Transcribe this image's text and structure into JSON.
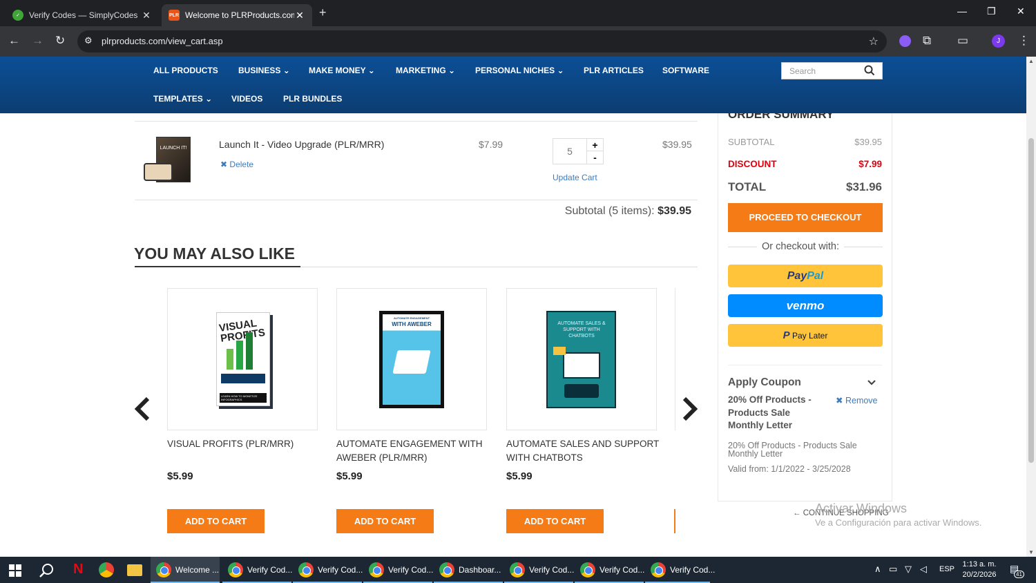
{
  "browser": {
    "tabs": [
      {
        "title": "Verify Codes — SimplyCodes",
        "active": false
      },
      {
        "title": "Welcome to PLRProducts.com -",
        "active": true
      }
    ],
    "tab2_favicon": "PLR",
    "url": "plrproducts.com/view_cart.asp",
    "profile_initial": "J"
  },
  "site_nav": {
    "row1": [
      "ALL PRODUCTS",
      "BUSINESS",
      "MAKE MONEY",
      "MARKETING",
      "PERSONAL NICHES",
      "PLR ARTICLES",
      "SOFTWARE"
    ],
    "row2": [
      "TEMPLATES",
      "VIDEOS",
      "PLR BUNDLES"
    ],
    "search_placeholder": "Search"
  },
  "cart": {
    "item": {
      "name": "Launch It - Video Upgrade (PLR/MRR)",
      "delete_label": "Delete",
      "unit_price": "$7.99",
      "quantity": "5",
      "line_total": "$39.95",
      "update_label": "Update Cart",
      "thumb_text": "LAUNCH IT!"
    },
    "subtotal_label": "Subtotal (5 items):",
    "subtotal_value": "$39.95"
  },
  "recommendations": {
    "heading": "YOU MAY ALSO LIKE",
    "products": [
      {
        "name": "VISUAL PROFITS (PLR/MRR)",
        "price": "$5.99",
        "cover_text": "VISUAL PROFITS",
        "cover_sub": "LEARN HOW TO MONETIZE INFOGRAPHICS"
      },
      {
        "name": "AUTOMATE ENGAGEMENT WITH AWEBER (PLR/MRR)",
        "price": "$5.99",
        "cover_text": "WITH AWEBER",
        "cover_sub": "AUTOMATE ENGAGEMENT"
      },
      {
        "name": "AUTOMATE SALES AND SUPPORT WITH CHATBOTS",
        "price": "$5.99",
        "cover_text": "AUTOMATE SALES & SUPPORT WITH CHATBOTS"
      }
    ],
    "add_label": "ADD TO CART"
  },
  "summary": {
    "title": "ORDER SUMMARY",
    "subtotal_label": "SUBTOTAL",
    "subtotal_value": "$39.95",
    "discount_label": "DISCOUNT",
    "discount_value": "$7.99",
    "total_label": "TOTAL",
    "total_value": "$31.96",
    "checkout_label": "PROCEED TO CHECKOUT",
    "or_checkout": "Or checkout with:",
    "paypal_a": "Pay",
    "paypal_b": "Pal",
    "venmo": "venmo",
    "paylater": "Pay Later",
    "coupon_heading": "Apply Coupon",
    "coupon_name": "20% Off Products - Products Sale Monthly Letter",
    "coupon_remove": "Remove",
    "coupon_desc": "20% Off Products - Products Sale Monthly Letter",
    "coupon_valid": "Valid from: 1/1/2022 - 3/25/2028",
    "continue_shopping": "CONTINUE SHOPPING"
  },
  "watermark": {
    "line1": "Activar Windows",
    "line2": "Ve a Configuración para activar Windows."
  },
  "taskbar": {
    "apps": [
      "Welcome ...",
      "Verify Cod...",
      "Verify Cod...",
      "Verify Cod...",
      "Dashboar...",
      "Verify Cod...",
      "Verify Cod...",
      "Verify Cod..."
    ],
    "lang": "ESP",
    "time": "1:13 a. m.",
    "date": "20/2/2026",
    "notifications": "41"
  },
  "colors": {
    "accent_orange": "#f47b16",
    "discount_red": "#e0000f",
    "nav_blue": "#0b4f96",
    "paypal_yellow": "#ffc439",
    "venmo_blue": "#008cff"
  }
}
